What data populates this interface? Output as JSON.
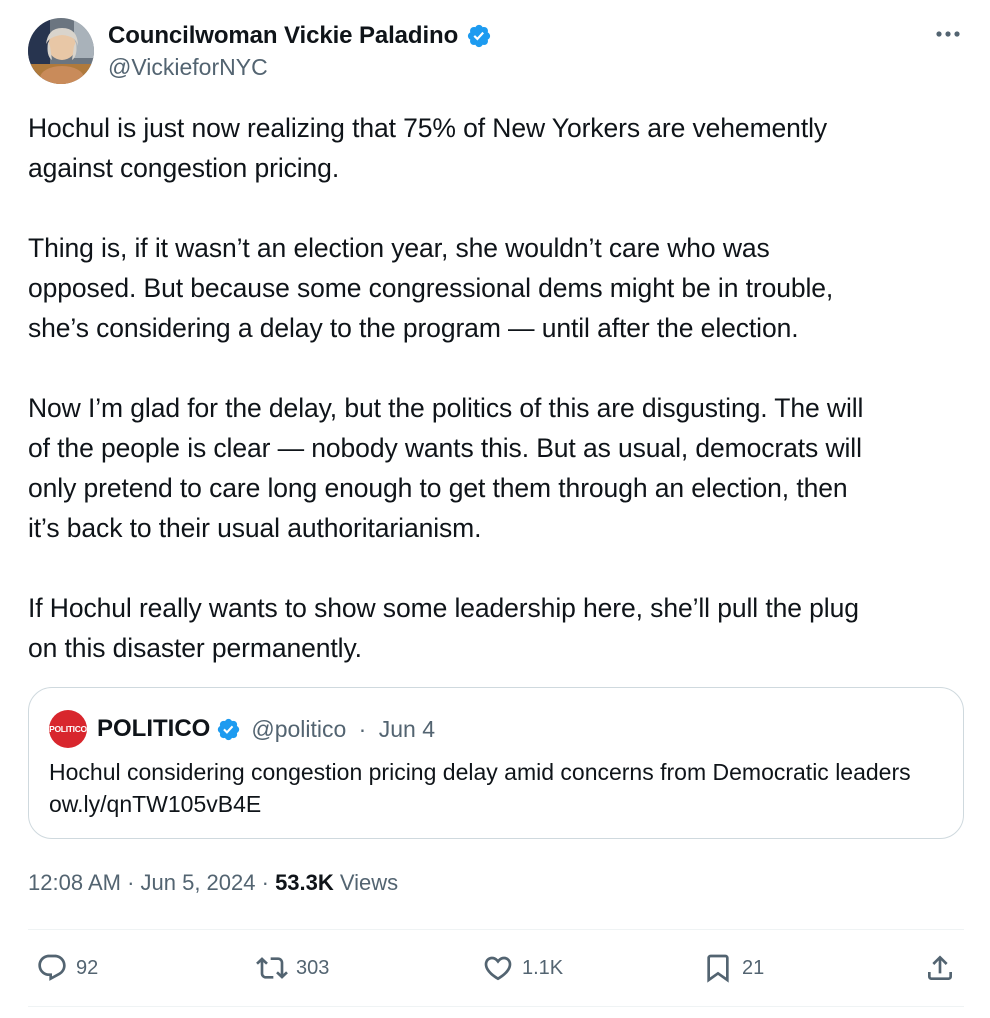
{
  "author": {
    "display_name": "Councilwoman Vickie Paladino",
    "handle": "@VickieforNYC"
  },
  "tweet": {
    "text": "Hochul is just now realizing that 75% of New Yorkers are vehemently\nagainst congestion pricing.\n\nThing is, if it wasn’t an election year, she wouldn’t care who was\nopposed. But because some congressional dems might be in trouble,\nshe’s considering a delay to the program — until after the election.\n\nNow I’m glad for the delay, but the politics of this are disgusting. The will\nof the people is clear — nobody wants this. But as usual, democrats will\nonly pretend to care long enough to get them through an election, then\nit’s back to their usual authoritarianism.\n\nIf Hochul really wants to show some leadership here, she’ll pull the plug\non this disaster permanently."
  },
  "quote": {
    "logo_text": "POLITICO",
    "display_name": "POLITICO",
    "handle": "@politico",
    "separator": " · ",
    "date": "Jun 4",
    "text": "Hochul considering congestion pricing delay amid concerns from Democratic leaders ow.ly/qnTW105vB4E"
  },
  "meta": {
    "time": "12:08 AM",
    "sep": " · ",
    "date": "Jun 5, 2024",
    "sep2": " · ",
    "views_count": "53.3K",
    "views_label": " Views"
  },
  "actions": {
    "replies": "92",
    "reposts": "303",
    "likes": "1.1K",
    "bookmarks": "21"
  },
  "colors": {
    "verified_blue": "#1d9bf0",
    "politico_red": "#d8262d",
    "secondary_text": "#536471"
  }
}
